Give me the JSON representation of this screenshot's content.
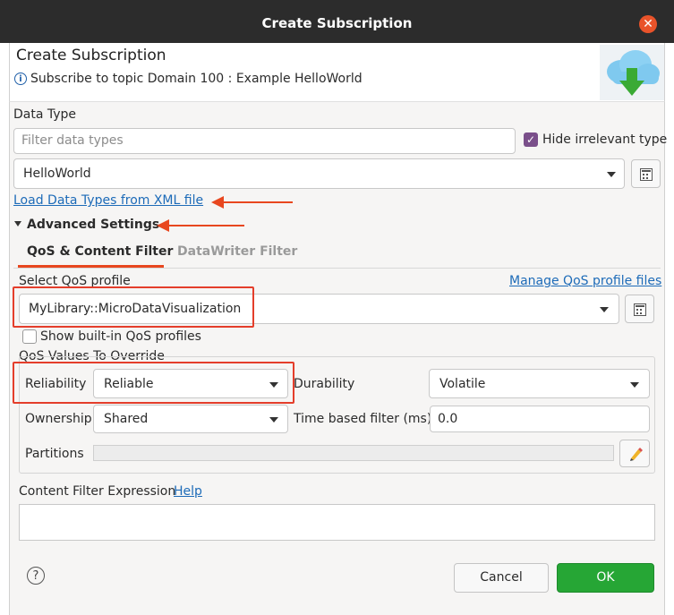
{
  "window": {
    "title": "Create Subscription"
  },
  "header": {
    "title": "Create Subscription",
    "subtitle": "Subscribe to topic Domain 100 : Example HelloWorld"
  },
  "data_type": {
    "label": "Data Type",
    "filter_placeholder": "Filter data types",
    "hide_irrelevant_label": "Hide irrelevant type",
    "hide_irrelevant_checked": true,
    "selected": "HelloWorld",
    "load_link": "Load Data Types from XML file"
  },
  "advanced": {
    "label": "Advanced Settings"
  },
  "tabs": [
    {
      "label": "QoS & Content Filter",
      "active": true
    },
    {
      "label": "DataWriter Filter",
      "active": false
    }
  ],
  "qos": {
    "select_label": "Select QoS profile",
    "manage_link": "Manage QoS profile files",
    "profile": "MyLibrary::MicroDataVisualization",
    "show_builtin_label": "Show built-in QoS profiles",
    "show_builtin_checked": false,
    "override_label": "QoS Values To Override",
    "reliability_label": "Reliability",
    "reliability_value": "Reliable",
    "durability_label": "Durability",
    "durability_value": "Volatile",
    "ownership_label": "Ownership",
    "ownership_value": "Shared",
    "time_filter_label": "Time based filter (ms)",
    "time_filter_value": "0.0",
    "partitions_label": "Partitions",
    "partitions_value": ""
  },
  "content_filter": {
    "label": "Content Filter Expression",
    "help_link": "Help",
    "value": ""
  },
  "footer": {
    "cancel_label": "Cancel",
    "ok_label": "OK"
  },
  "colors": {
    "ok_green": "#26a635",
    "annotation_red": "#e8471f",
    "titlebar": "#2c2c2c",
    "close_orange": "#e9532a"
  }
}
